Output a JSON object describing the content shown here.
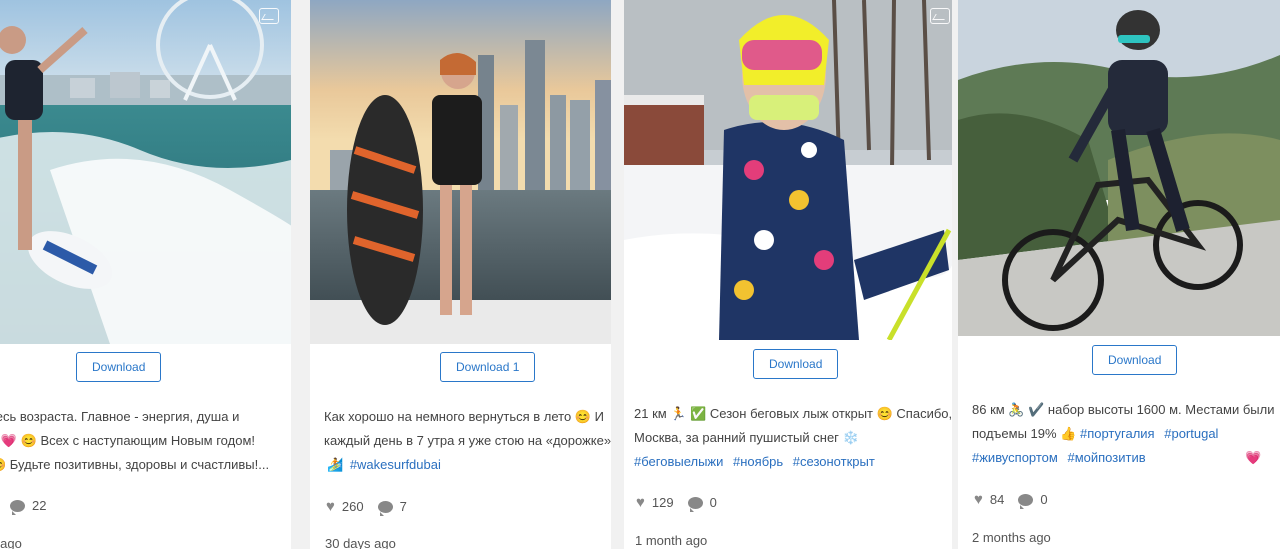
{
  "posts": [
    {
      "download_label": "Download",
      "caption_lines": [
        "тесь возраста. Главное - энергия, душа и",
        "а 💗 😊  Всех с наступающим Новым годом!",
        "😊 Будьте позитивны, здоровы и счастливы!..."
      ],
      "tags": [],
      "likes": "",
      "comments": "22",
      "time": "s ago"
    },
    {
      "download_label": "Download 1",
      "caption_lines": [
        "Как хорошо на немного вернуться в лето 😊  И",
        "каждый день в 7 утра я уже стою на «дорожке»"
      ],
      "emoji_prefix": "🏄",
      "tags": [
        "#wakesurfdubai"
      ],
      "likes": "260",
      "comments": "7",
      "time": "30 days ago"
    },
    {
      "download_label": "Download",
      "caption_lines": [
        "21 км 🏃 ✅  Сезон беговых лыж открыт 😊  Спасибо,",
        "Москва, за ранний пушистый снег ❄️"
      ],
      "tags": [
        "#беговыелыжи",
        "#ноябрь",
        "#сезоноткрыт"
      ],
      "likes": "129",
      "comments": "0",
      "time": "1 month ago"
    },
    {
      "download_label": "Download",
      "caption_lines": [
        "86 км 🚴 ✔️  набор высоты 1600 м. Местами были",
        "подъемы 19% 👍"
      ],
      "inline_tags": [
        "#португалия",
        "#portugal"
      ],
      "tags": [
        "#живуспортом",
        "#мойпозитив"
      ],
      "tail_emoji": "💗",
      "likes": "84",
      "comments": "0",
      "time": "2 months ago"
    }
  ],
  "icons": {
    "heart": "heart-icon",
    "comment": "comment-icon",
    "instagram_badge": "instagram-badge-icon"
  }
}
